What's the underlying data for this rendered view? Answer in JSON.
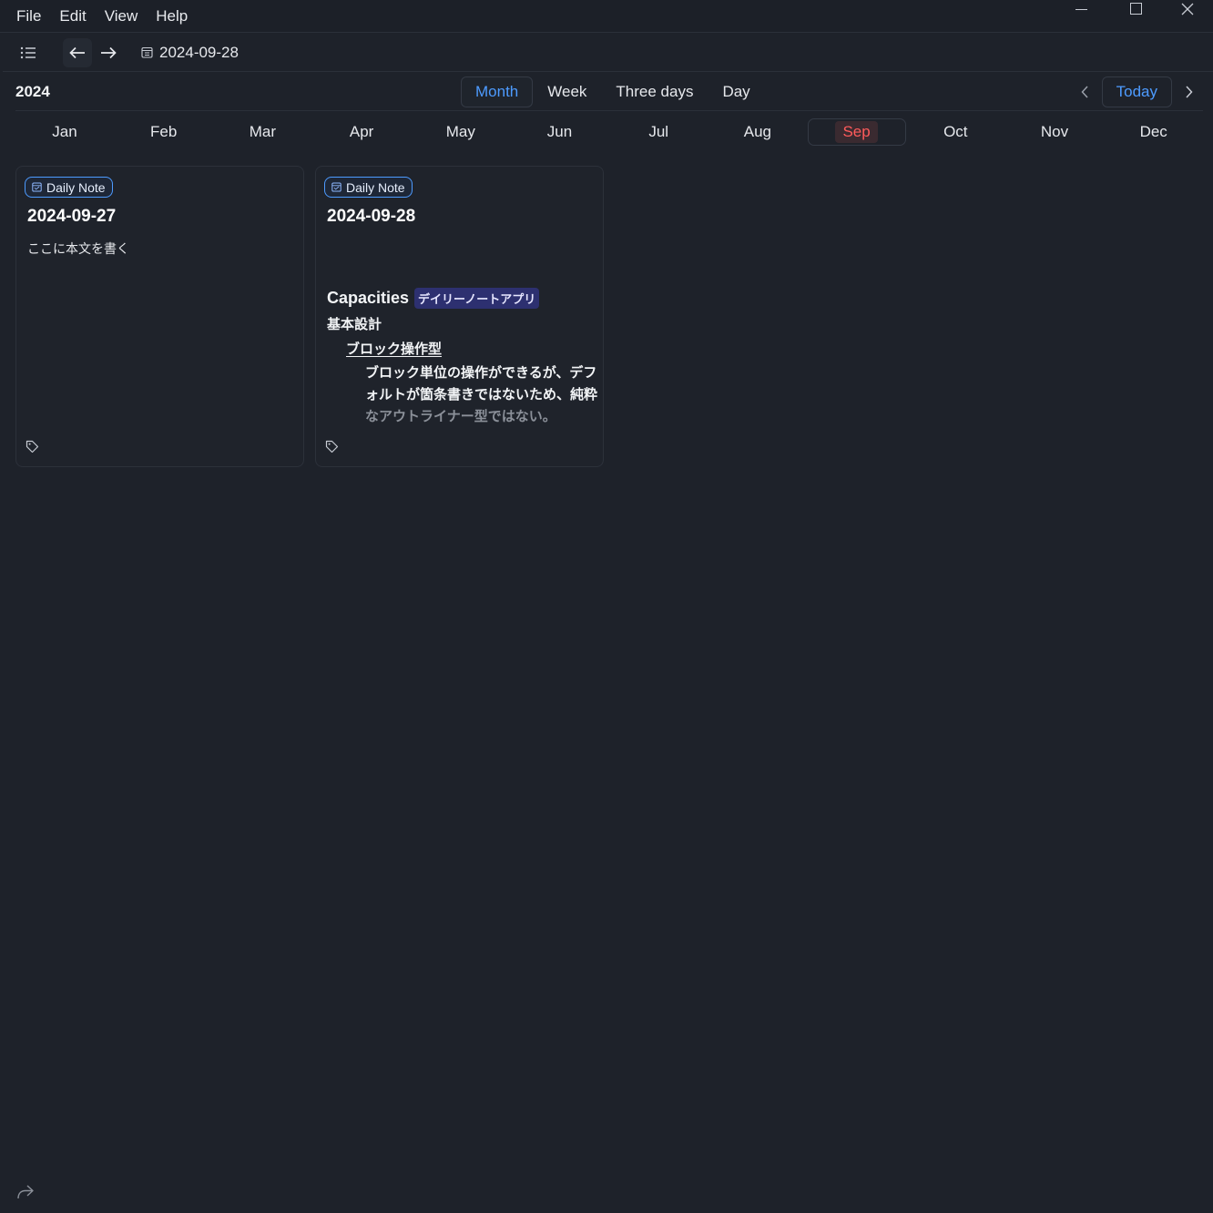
{
  "menu": [
    "File",
    "Edit",
    "View",
    "Help"
  ],
  "toolbar": {
    "current_date": "2024-09-28"
  },
  "view": {
    "year": "2024",
    "modes": [
      "Month",
      "Week",
      "Three days",
      "Day"
    ],
    "active_mode": "Month",
    "today_label": "Today"
  },
  "months": [
    "Jan",
    "Feb",
    "Mar",
    "Apr",
    "May",
    "Jun",
    "Jul",
    "Aug",
    "Sep",
    "Oct",
    "Nov",
    "Dec"
  ],
  "active_month": "Sep",
  "cards": [
    {
      "badge": "Daily Note",
      "title": "2024-09-27",
      "body": "ここに本文を書く"
    },
    {
      "badge": "Daily Note",
      "title": "2024-09-28",
      "doc": {
        "heading": "Capacities",
        "heading_tag": "デイリーノートアプリ",
        "level2": "基本設計",
        "level3": "ブロック操作型",
        "level4_line1": "ブロック単位の操作ができるが、デフ",
        "level4_line2": "ォルトが箇条書きではないため、純粋",
        "level4_line3": "なアウトライナー型ではない。"
      }
    }
  ],
  "colors": {
    "background": "#1e222a",
    "accent": "#4d9bff",
    "today_month": "#ff5b5b",
    "tag_pill": "#2d3070"
  },
  "icons": [
    "sidebar-list-icon",
    "arrow-left-icon",
    "arrow-right-icon",
    "calendar-icon",
    "chevron-left-icon",
    "chevron-right-icon",
    "tag-icon",
    "share-icon"
  ]
}
